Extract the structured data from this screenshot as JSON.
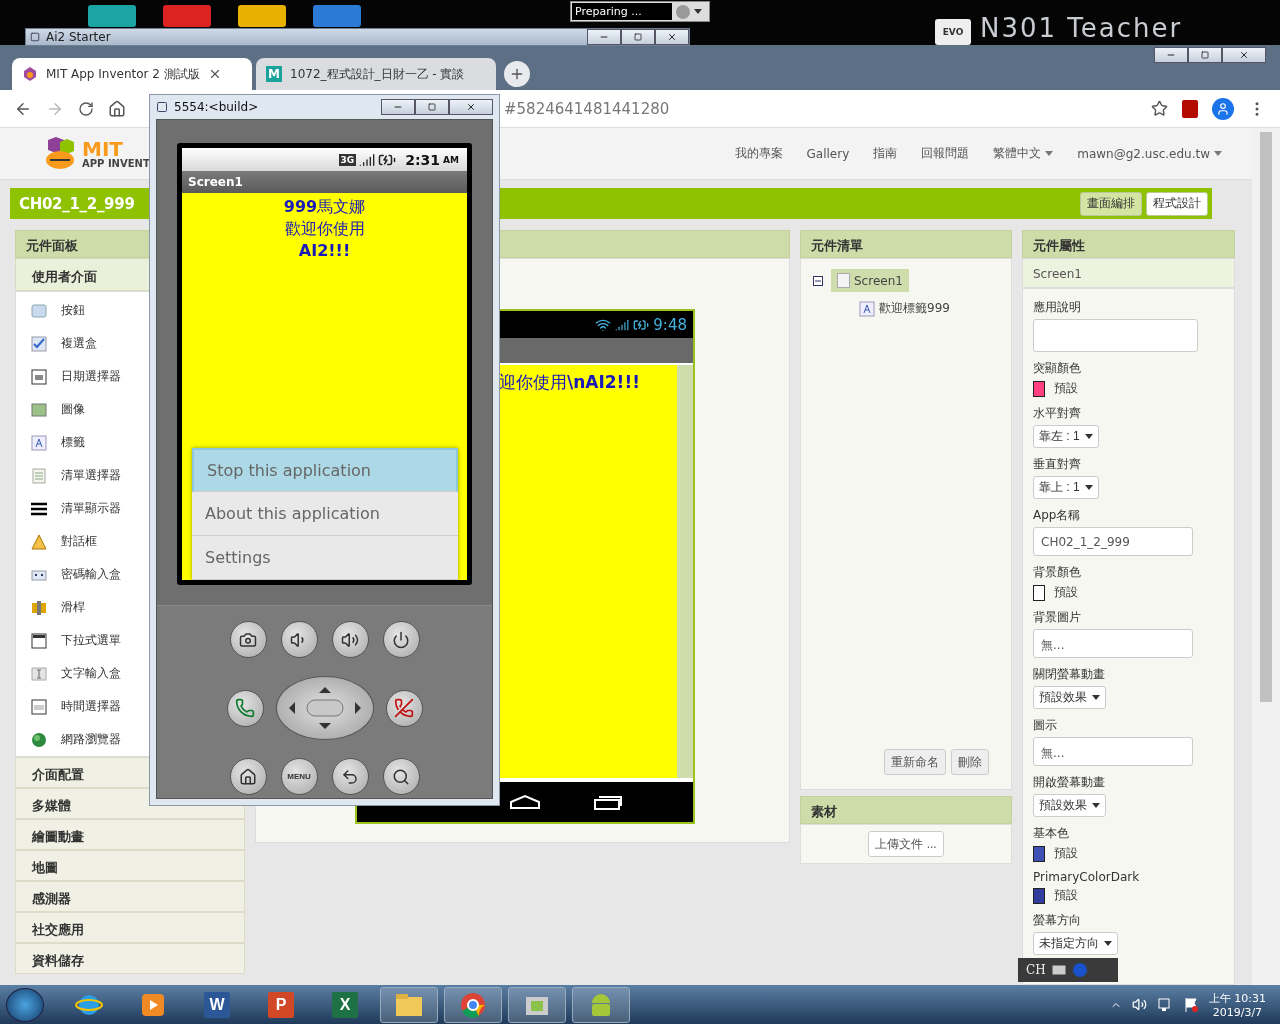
{
  "desktop": {
    "icons": [
      {
        "kind": "teal"
      },
      {
        "kind": "red"
      },
      {
        "kind": "yellow"
      },
      {
        "kind": "blue"
      }
    ],
    "starter_window": {
      "title": "Ai2 Starter"
    },
    "status_widget": {
      "text": "Preparing ..."
    },
    "cloud_badge": {
      "text": "EVO"
    },
    "machine_label": "N301 Teacher"
  },
  "browser": {
    "tabs": [
      {
        "title": "MIT App Inventor 2 測試版",
        "selected": true,
        "kind": "ai"
      },
      {
        "title": "1072_程式設計_日財一乙 - 實談",
        "selected": false,
        "kind": "moodle",
        "glyph": "M"
      }
    ],
    "url": "#5824641481441280"
  },
  "page": {
    "logo": {
      "title": "MIT",
      "subtitle": "APP INVENT"
    },
    "nav": [
      {
        "label": "我的專案",
        "menu": false
      },
      {
        "label": "Gallery",
        "menu": false
      },
      {
        "label": "指南",
        "menu": false
      },
      {
        "label": "回報問題",
        "menu": false
      },
      {
        "label": "繁體中文",
        "menu": true
      },
      {
        "label": "mawn@g2.usc.edu.tw",
        "menu": true
      }
    ],
    "project": {
      "name": "CH02_1_2_999",
      "views": [
        {
          "label": "畫面編排",
          "selected": true
        },
        {
          "label": "程式設計",
          "selected": false
        }
      ]
    },
    "palette": {
      "title": "元件面板",
      "group": "使用者介面",
      "items": [
        {
          "label": "按鈕",
          "kind": "button"
        },
        {
          "label": "複選盒",
          "kind": "checkbox"
        },
        {
          "label": "日期選擇器",
          "kind": "datepicker"
        },
        {
          "label": "圖像",
          "kind": "image"
        },
        {
          "label": "標籤",
          "kind": "label"
        },
        {
          "label": "清單選擇器",
          "kind": "listpicker"
        },
        {
          "label": "清單顯示器",
          "kind": "listview"
        },
        {
          "label": "對話框",
          "kind": "notifier"
        },
        {
          "label": "密碼輸入盒",
          "kind": "password"
        },
        {
          "label": "滑桿",
          "kind": "slider"
        },
        {
          "label": "下拉式選單",
          "kind": "spinner"
        },
        {
          "label": "文字輸入盒",
          "kind": "textbox"
        },
        {
          "label": "時間選擇器",
          "kind": "timepicker"
        },
        {
          "label": "網路瀏覽器",
          "kind": "webviewer"
        }
      ],
      "categories": [
        "介面配置",
        "多媒體",
        "繪圖動畫",
        "地圖",
        "感測器",
        "社交應用",
        "資料儲存"
      ]
    },
    "viewer": {
      "time": "9:48",
      "label_text": "迎你使用**\\nAI2!!!**"
    },
    "components": {
      "title": "元件清單",
      "tree": [
        {
          "name": "Screen1",
          "kind": "screen",
          "selected": true,
          "expanded": true,
          "children": [
            {
              "name": "歡迎標籤999",
              "kind": "label",
              "selected": false
            }
          ]
        }
      ],
      "buttons": [
        "重新命名",
        "刪除"
      ]
    },
    "assets": {
      "title": "素材",
      "button": "上傳文件 ..."
    },
    "properties": {
      "title": "元件屬性",
      "component": "Screen1",
      "items": [
        {
          "label": "應用說明",
          "kind": "textarea"
        },
        {
          "label": "突顯顏色",
          "kind": "color",
          "color": "#ff4081",
          "value": "預設"
        },
        {
          "label": "水平對齊",
          "kind": "dropdown",
          "value": "靠左 : 1"
        },
        {
          "label": "垂直對齊",
          "kind": "dropdown",
          "value": "靠上 : 1"
        },
        {
          "label": "App名稱",
          "kind": "text",
          "value": "CH02_1_2_999"
        },
        {
          "label": "背景顏色",
          "kind": "color",
          "color": "#ffffff",
          "value": "預設"
        },
        {
          "label": "背景圖片",
          "kind": "text",
          "value": "無..."
        },
        {
          "label": "關閉螢幕動畫",
          "kind": "dropdown",
          "value": "預設效果"
        },
        {
          "label": "圖示",
          "kind": "text",
          "value": "無..."
        },
        {
          "label": "開啟螢幕動畫",
          "kind": "dropdown",
          "value": "預設效果"
        },
        {
          "label": "基本色",
          "kind": "color",
          "color": "#3f51b5",
          "value": "預設"
        },
        {
          "label": "PrimaryColorDark",
          "kind": "color",
          "color": "#303f9f",
          "value": "預設"
        },
        {
          "label": "螢幕方向",
          "kind": "dropdown",
          "value": "未指定方向"
        }
      ]
    }
  },
  "emulator": {
    "title": "5554:<build>",
    "time": "2:31",
    "ampm": "AM",
    "network": "3G",
    "screen_title": "Screen1",
    "label_lines": [
      "**999**馬文娜",
      "歡迎你使用",
      "**AI2!!!**"
    ],
    "menu": [
      {
        "label": "Stop this application",
        "selected": true
      },
      {
        "label": "About this application",
        "selected": false
      },
      {
        "label": "Settings",
        "selected": false
      }
    ],
    "key_rows": [
      {
        "keys": [
          {
            "kind": "camera"
          },
          {
            "kind": "volume-down"
          },
          {
            "kind": "volume-up"
          },
          {
            "kind": "power"
          }
        ]
      },
      {
        "keys": [
          {
            "kind": "call"
          },
          {
            "kind": "dpad"
          },
          {
            "kind": "end-call"
          }
        ]
      },
      {
        "keys": [
          {
            "kind": "home"
          },
          {
            "kind": "menu",
            "label": "MENU"
          },
          {
            "kind": "back"
          },
          {
            "kind": "search"
          }
        ]
      }
    ]
  },
  "language_bar": {
    "text": "CH"
  },
  "taskbar": {
    "apps": [
      {
        "kind": "ie"
      },
      {
        "kind": "media"
      },
      {
        "kind": "office",
        "letter": "W",
        "color": "#2b5797"
      },
      {
        "kind": "office",
        "letter": "P",
        "color": "#d24726"
      },
      {
        "kind": "office",
        "letter": "X",
        "color": "#1e7145"
      },
      {
        "kind": "folder"
      },
      {
        "kind": "chrome"
      },
      {
        "kind": "sdk"
      },
      {
        "kind": "android"
      }
    ],
    "time": "上午 10:31",
    "date": "2019/3/7"
  }
}
